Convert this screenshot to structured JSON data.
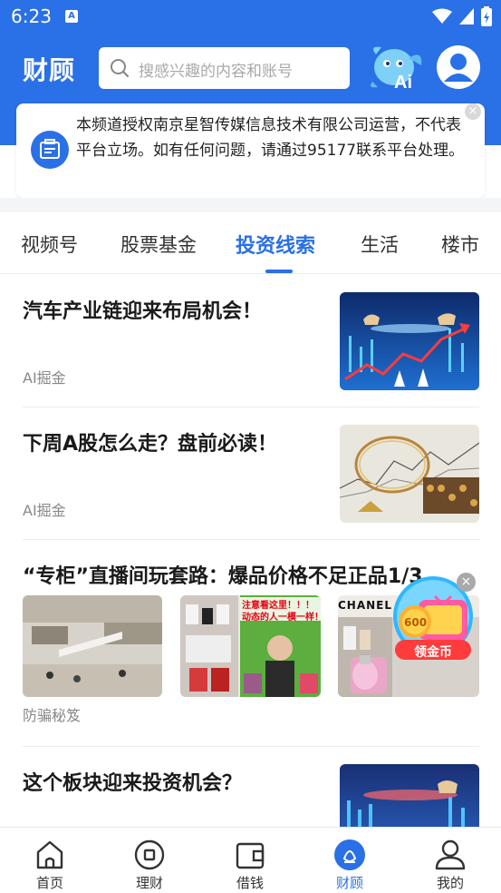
{
  "status_bar": {
    "time": "6:23",
    "notification_badge": "A"
  },
  "header": {
    "title": "财顾",
    "search_placeholder": "搜感兴趣的内容和账号",
    "ai_label": "Ai"
  },
  "notice": {
    "text": "本频道授权南京星智传媒信息技术有限公司运营，不代表平台立场。如有任何问题，请通过95177联系平台处理。",
    "close": "×"
  },
  "tabs": [
    {
      "label": "视频号",
      "active": false
    },
    {
      "label": "股票基金",
      "active": false
    },
    {
      "label": "投资线索",
      "active": true
    },
    {
      "label": "生活",
      "active": false
    },
    {
      "label": "楼市",
      "active": false
    }
  ],
  "feed": {
    "articles": [
      {
        "title": "汽车产业链迎来布局机会！",
        "source": "AI掘金"
      },
      {
        "title": "下周A股怎么走？盘前必读！",
        "source": "AI掘金"
      },
      {
        "title": "“专柜”直播间玩套路：爆品价格不足正品1/3",
        "source": "防骗秘笈",
        "thumb_captions": [
          "注意看这里！！！",
          "动态的人一模一样！"
        ],
        "brand_text": "CHANEL"
      },
      {
        "title": "这个板块迎来投资机会？",
        "source": ""
      }
    ]
  },
  "coin_widget": {
    "amount": "600",
    "label": "领金币",
    "close": "×"
  },
  "bottom_nav": [
    {
      "label": "首页",
      "icon": "home-icon",
      "active": false
    },
    {
      "label": "理财",
      "icon": "coin-icon",
      "active": false
    },
    {
      "label": "借钱",
      "icon": "wallet-icon",
      "active": false
    },
    {
      "label": "财顾",
      "icon": "advisor-icon",
      "active": true
    },
    {
      "label": "我的",
      "icon": "profile-icon",
      "active": false
    }
  ],
  "colors": {
    "brand": "#2a70e6",
    "text": "#1a1a1a",
    "muted": "#888888"
  }
}
